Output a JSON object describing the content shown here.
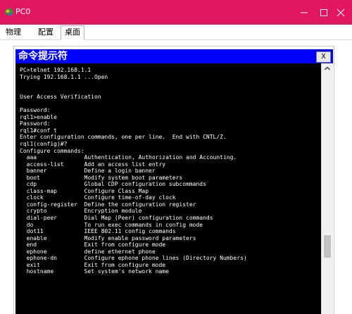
{
  "window": {
    "title": "PC0",
    "minimize_glyph": "—",
    "maximize_glyph": "☐",
    "close_glyph": "✕",
    "accent_color": "#e3175f"
  },
  "menu": {
    "tabs": [
      "物理",
      "配置",
      "桌面"
    ],
    "active_tab": "桌面"
  },
  "command_prompt": {
    "title": "命令提示符",
    "close_label": "X",
    "lines": [
      "PC>telnet 192.168.1.1",
      "Trying 192.168.1.1 ...Open",
      "",
      "",
      "User Access Verification",
      "",
      "Password:",
      "rql1>enable",
      "Password:",
      "rql1#conf t",
      "Enter configuration commands, one per line.  End with CNTL/Z.",
      "rql1(config)#?",
      "Configure commands:",
      "  aaa              Authentication, Authorization and Accounting.",
      "  access-list      Add an access list entry",
      "  banner           Define a login banner",
      "  boot             Modify system boot parameters",
      "  cdp              Global CDP configuration subcommands",
      "  class-map        Configure Class Map",
      "  clock            Configure time-of-day clock",
      "  config-register  Define the configuration register",
      "  crypto           Encryption module",
      "  dial-peer        Dial Map (Peer) configuration commands",
      "  do               To run exec commands in config mode",
      "  dot11            IEEE 802.11 config commands",
      "  enable           Modify enable password parameters",
      "  end              Exit from configure mode",
      "  ephone           define ethernet phone",
      "  ephone-dn        Configure ephone phone lines (Directory Numbers)",
      "  exit             Exit from configure mode",
      "  hostname         Set system's network name"
    ]
  }
}
